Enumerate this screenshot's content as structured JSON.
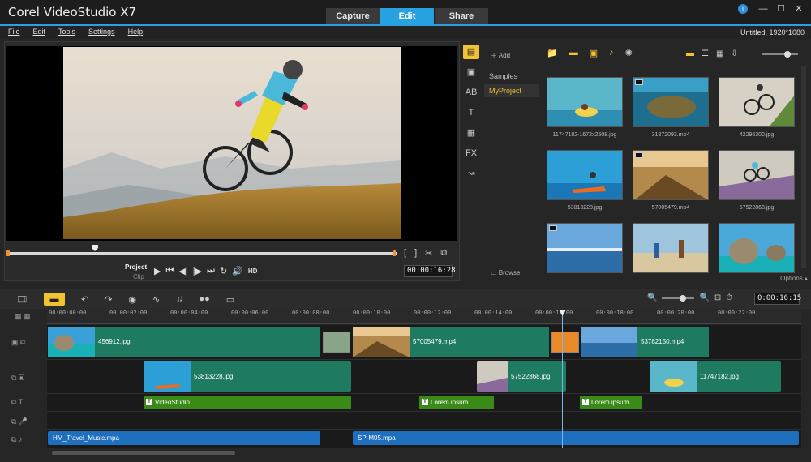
{
  "app": {
    "title": "Corel VideoStudio X7",
    "modes": [
      "Capture",
      "Edit",
      "Share"
    ],
    "active_mode": "Edit",
    "colors": {
      "accent": "#27a1e0",
      "library_highlight": "#f1c232",
      "video_clip": "#1e7a60",
      "title_clip": "#3a8a18",
      "audio_clip": "#1f6fbf"
    }
  },
  "menu": {
    "items": [
      "File",
      "Edit",
      "Tools",
      "Settings",
      "Help"
    ],
    "project_info": "Untitled, 1920*1080"
  },
  "player": {
    "project_label": "Project",
    "clip_label": "Clip",
    "hd_label": "HD",
    "timecode": "00:00:16:28",
    "mark_in": "[",
    "mark_out": "]"
  },
  "library": {
    "add_label": "Add",
    "folders": [
      "Samples",
      "MyProject"
    ],
    "selected_folder": "MyProject",
    "browse_label": "Browse",
    "options_label": "Options",
    "media": [
      {
        "name": "11747182-1672x2508.jpg",
        "type": "image"
      },
      {
        "name": "31872093.mp4",
        "type": "video"
      },
      {
        "name": "42296300.jpg",
        "type": "image"
      },
      {
        "name": "53813228.jpg",
        "type": "image"
      },
      {
        "name": "57005479.mp4",
        "type": "video"
      },
      {
        "name": "57522868.jpg",
        "type": "image"
      },
      {
        "name": "",
        "type": "video"
      },
      {
        "name": "",
        "type": "image"
      },
      {
        "name": "",
        "type": "image"
      }
    ]
  },
  "timeline": {
    "timecode": "0:00:16:15",
    "ruler": [
      "00:00:00:00",
      "00:00:02:00",
      "00:00:04:00",
      "00:00:06:00",
      "00:00:08:00",
      "00:00:10:00",
      "00:00:12:00",
      "00:00:14:00",
      "00:00:16:00",
      "00:00:18:00",
      "00:00:20:00",
      "00:00:22:00"
    ],
    "video_track": [
      "456912.jpg",
      "57005479.mp4",
      "53782150.mp4"
    ],
    "overlay_track": [
      "53813228.jpg",
      "57522868.jpg",
      "11747182.jpg"
    ],
    "title_track": [
      "VideoStudio",
      "Lorem ipsum",
      "Lorem ipsum"
    ],
    "music_track": [
      "HM_Travel_Music.mpa",
      "SP-M05.mpa"
    ]
  }
}
